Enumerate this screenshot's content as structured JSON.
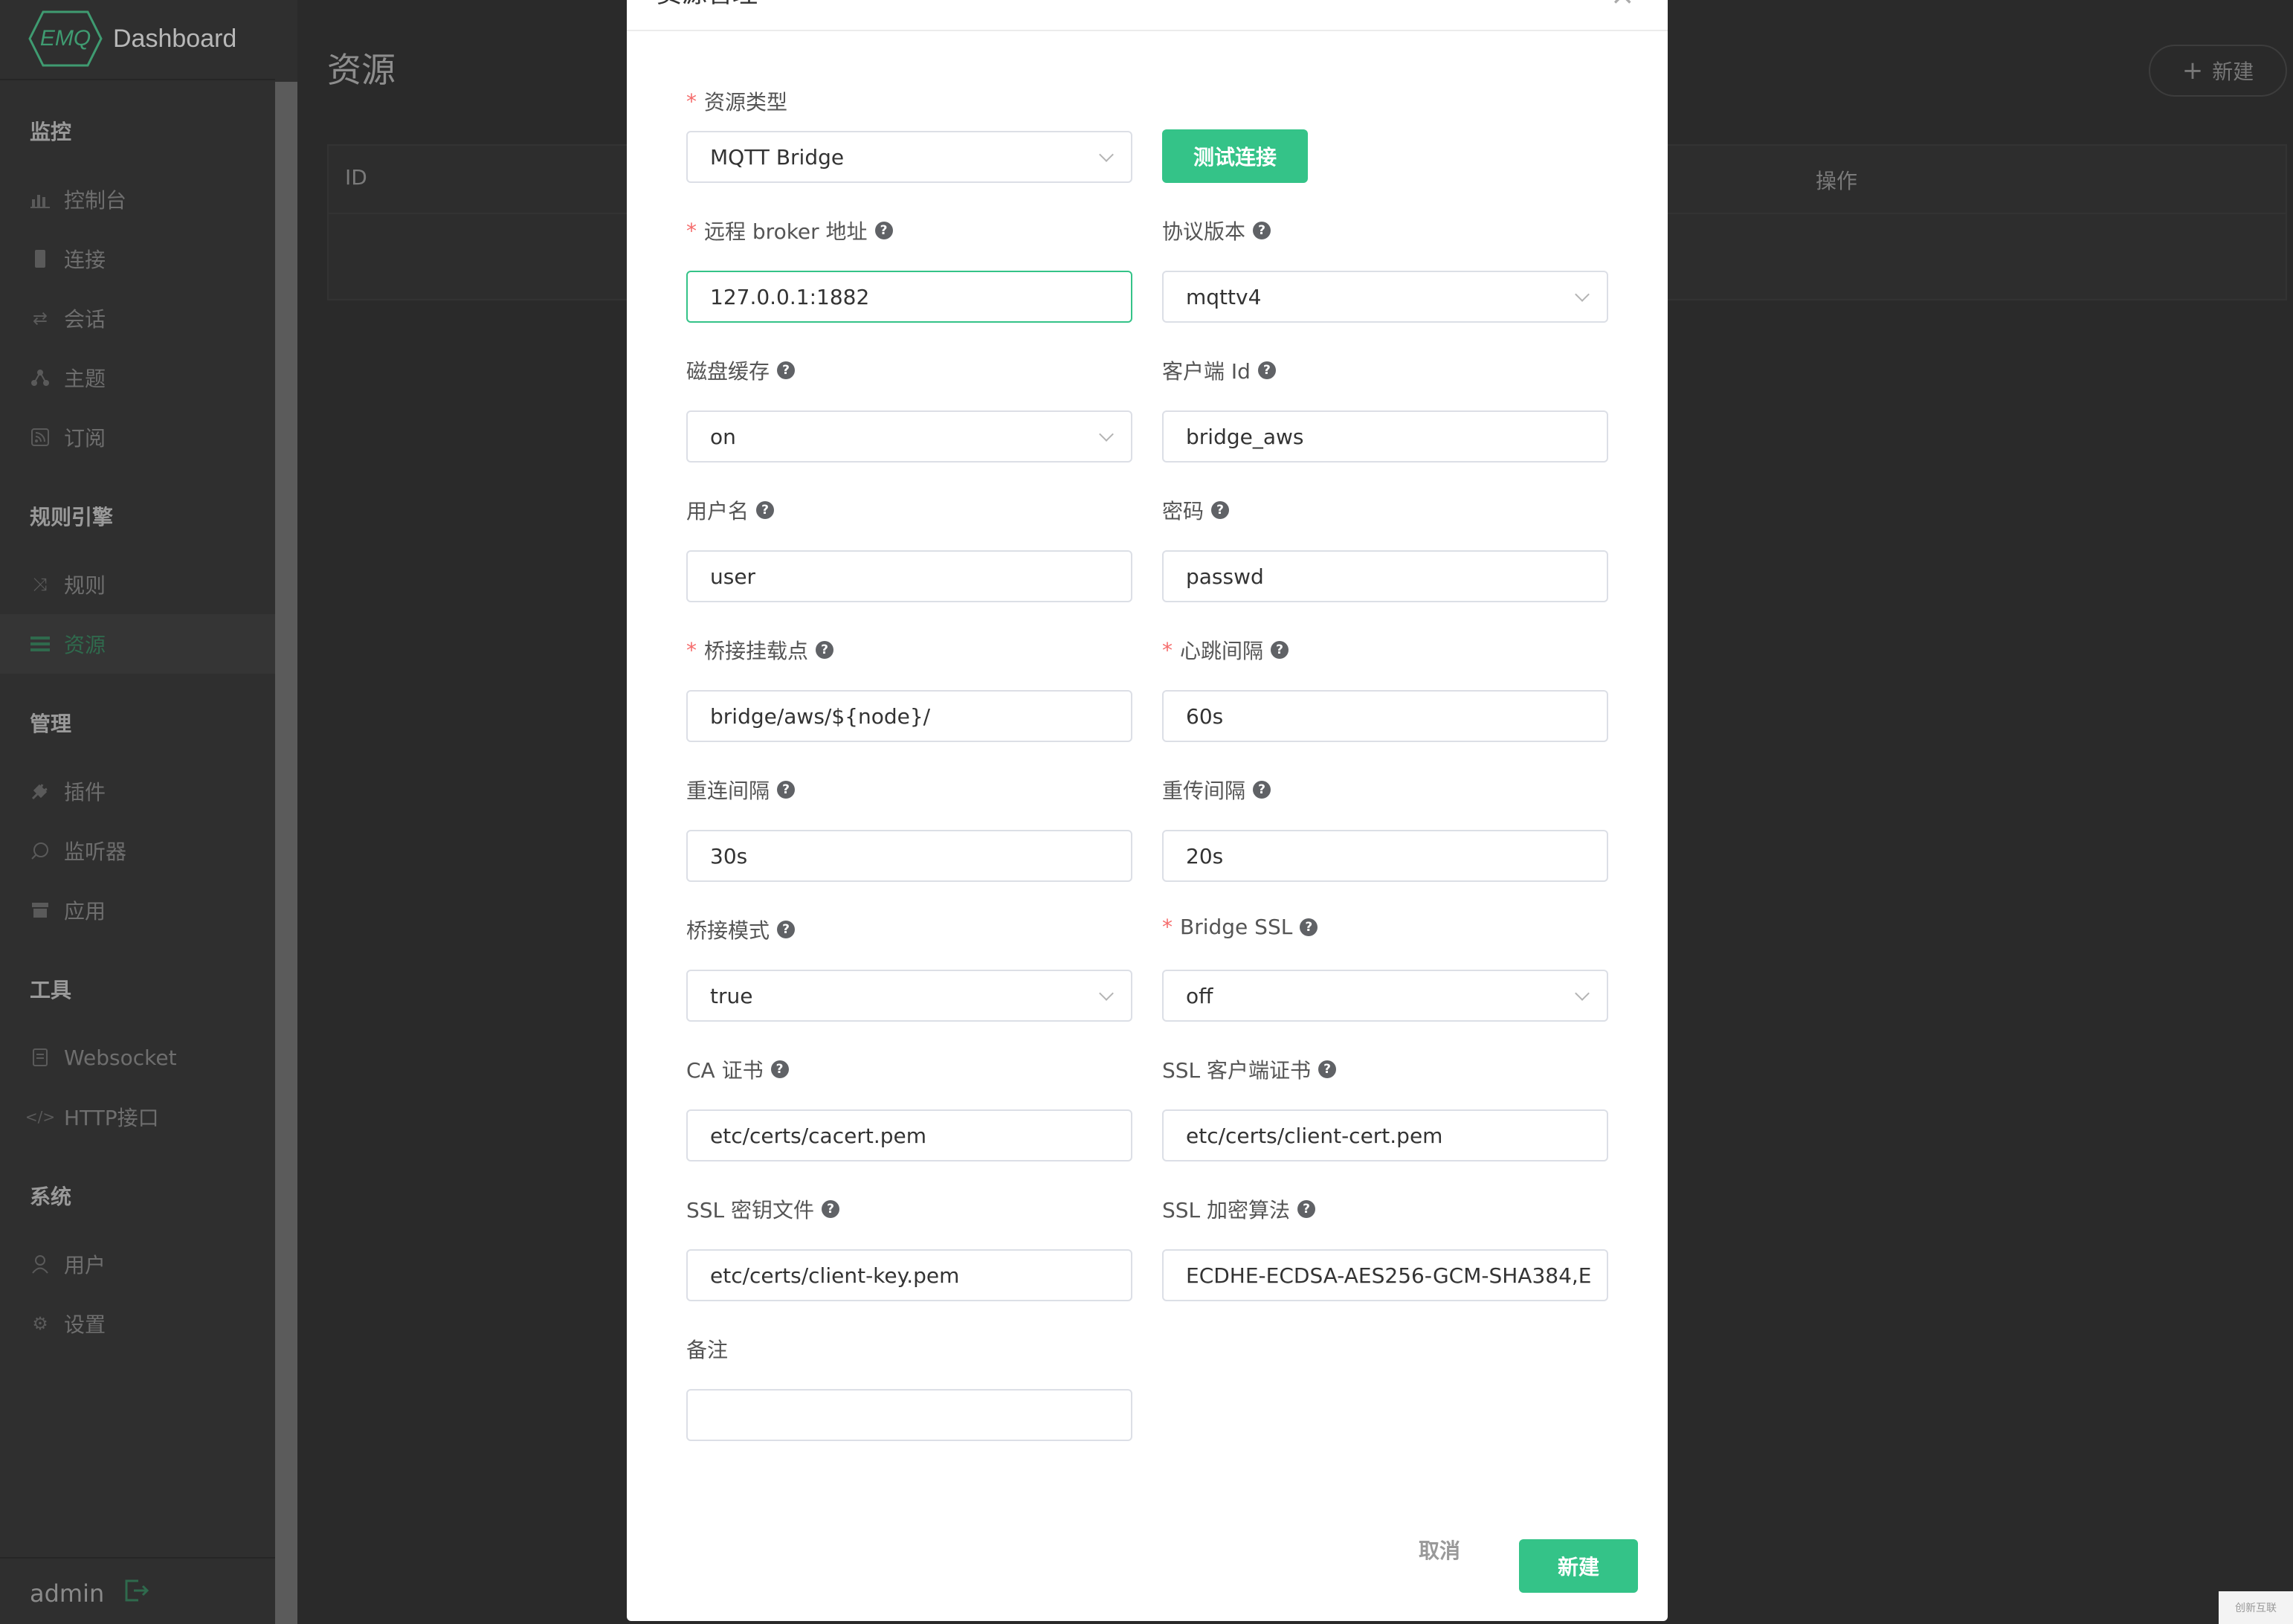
{
  "logo": {
    "mark": "EMQ",
    "title": "Dashboard"
  },
  "sidebar": {
    "groups": [
      {
        "title": "监控"
      },
      {
        "title": "规则引擎"
      },
      {
        "title": "管理"
      },
      {
        "title": "工具"
      },
      {
        "title": "系统"
      }
    ],
    "items": [
      {
        "label": "控制台",
        "icon": "bar-chart-icon"
      },
      {
        "label": "连接",
        "icon": "device-icon"
      },
      {
        "label": "会话",
        "icon": "swap-icon"
      },
      {
        "label": "主题",
        "icon": "topic-icon"
      },
      {
        "label": "订阅",
        "icon": "rss-icon"
      },
      {
        "label": "规则",
        "icon": "shuffle-icon"
      },
      {
        "label": "资源",
        "icon": "list-icon"
      },
      {
        "label": "插件",
        "icon": "plug-icon"
      },
      {
        "label": "监听器",
        "icon": "listener-icon"
      },
      {
        "label": "应用",
        "icon": "app-icon"
      },
      {
        "label": "Websocket",
        "icon": "websocket-icon"
      },
      {
        "label": "HTTP接口",
        "icon": "code-icon"
      },
      {
        "label": "用户",
        "icon": "user-icon"
      },
      {
        "label": "设置",
        "icon": "gear-icon"
      }
    ],
    "active_item": "资源",
    "user": "admin"
  },
  "page": {
    "title": "资源",
    "new_button": "新建",
    "table_headers": {
      "id": "ID",
      "actions": "操作"
    }
  },
  "modal": {
    "title": "资源管理",
    "fields": {
      "resource_type": {
        "label": "资源类型",
        "value": "MQTT Bridge"
      },
      "broker": {
        "label": "远程 broker 地址",
        "value": "127.0.0.1:1882"
      },
      "proto": {
        "label": "协议版本",
        "value": "mqttv4"
      },
      "disk_cache": {
        "label": "磁盘缓存",
        "value": "on"
      },
      "client_id": {
        "label": "客户端 Id",
        "value": "bridge_aws"
      },
      "username": {
        "label": "用户名",
        "value": "user"
      },
      "password": {
        "label": "密码",
        "value": "passwd"
      },
      "mountpoint": {
        "label": "桥接挂载点",
        "value": "bridge/aws/${node}/"
      },
      "keepalive": {
        "label": "心跳间隔",
        "value": "60s"
      },
      "reconnect": {
        "label": "重连间隔",
        "value": "30s"
      },
      "retry": {
        "label": "重传间隔",
        "value": "20s"
      },
      "bridge_mode": {
        "label": "桥接模式",
        "value": "true"
      },
      "bridge_ssl": {
        "label": "Bridge SSL",
        "value": "off"
      },
      "ca_cert": {
        "label": "CA 证书",
        "value": "etc/certs/cacert.pem"
      },
      "client_cert": {
        "label": "SSL 客户端证书",
        "value": "etc/certs/client-cert.pem"
      },
      "key_file": {
        "label": "SSL 密钥文件",
        "value": "etc/certs/client-key.pem"
      },
      "ciphers": {
        "label": "SSL 加密算法",
        "value": "ECDHE-ECDSA-AES256-GCM-SHA384,E"
      },
      "remark": {
        "label": "备注",
        "value": ""
      }
    },
    "test_button": "测试连接",
    "cancel_button": "取消",
    "create_button": "新建"
  },
  "watermark": "创新互联",
  "colors": {
    "accent": "#34c388",
    "required": "#f56c6c",
    "sidebar": "#2f2f2f"
  }
}
